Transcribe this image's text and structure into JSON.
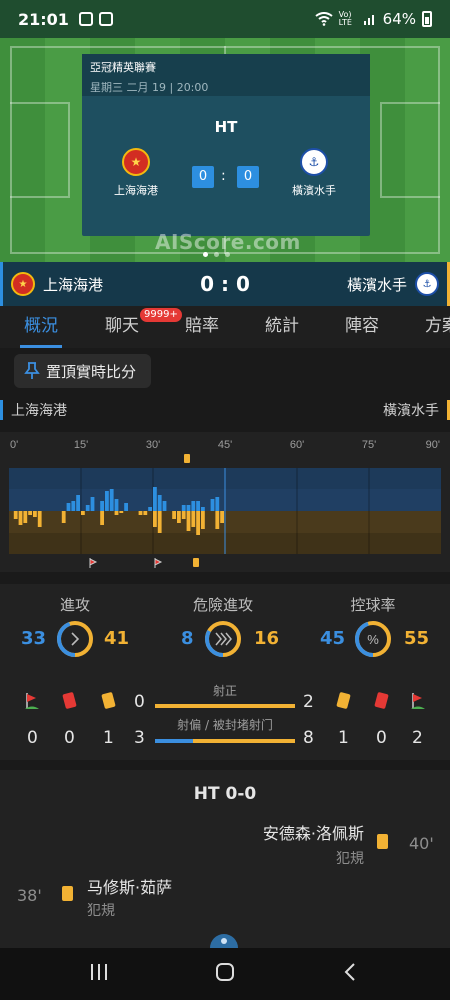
{
  "statusbar": {
    "time": "21:01",
    "battery": "64%",
    "network": "Vo) LTE"
  },
  "scorecard": {
    "competition": "亞冠精英聯賽",
    "date": "星期三 二月 19 | 20:00",
    "status": "HT",
    "home_name": "上海海港",
    "away_name": "橫濱水手",
    "home_score": "0",
    "away_score": "0",
    "separator": ":"
  },
  "watermark": "AIScore.com",
  "header": {
    "home": "上海海港",
    "away": "橫濱水手",
    "score": "0 : 0"
  },
  "tabs": [
    {
      "label": "概況",
      "active": true
    },
    {
      "label": "聊天",
      "badge": "9999+"
    },
    {
      "label": "賠率"
    },
    {
      "label": "統計"
    },
    {
      "label": "陣容"
    },
    {
      "label": "方案"
    }
  ],
  "pin_button": "置頂實時比分",
  "team_labels": {
    "home": "上海海港",
    "away": "橫濱水手"
  },
  "momentum": {
    "ticks": [
      "0'",
      "15'",
      "30'",
      "45'",
      "60'",
      "75'",
      "90'"
    ],
    "current_minute": 45,
    "home": [
      0,
      0,
      0,
      0,
      0,
      0,
      0,
      0,
      0,
      0,
      0,
      0,
      8,
      10,
      16,
      0,
      6,
      14,
      0,
      10,
      20,
      22,
      12,
      0,
      8,
      0,
      0,
      0,
      0,
      4,
      24,
      16,
      10,
      0,
      0,
      0,
      6,
      6,
      10,
      10,
      4,
      0,
      12,
      14,
      0
    ],
    "away": [
      0,
      8,
      14,
      12,
      4,
      6,
      16,
      0,
      0,
      0,
      0,
      12,
      0,
      0,
      0,
      4,
      0,
      0,
      0,
      14,
      0,
      0,
      4,
      2,
      0,
      0,
      0,
      4,
      4,
      0,
      16,
      22,
      0,
      0,
      8,
      12,
      8,
      20,
      16,
      24,
      18,
      0,
      0,
      18,
      12
    ]
  },
  "stats": {
    "attack": {
      "label": "進攻",
      "home": 33,
      "away": 41
    },
    "dangerous_attack": {
      "label": "危險進攻",
      "home": 8,
      "away": 16
    },
    "possession": {
      "label": "控球率",
      "home": 45,
      "away": 55
    },
    "shots_on_target": {
      "label": "射正",
      "home": 0,
      "away": 2
    },
    "shots_off": {
      "label": "射偏 / 被封堵射门",
      "home": 3,
      "away": 8
    },
    "home_corners": 0,
    "home_red": 0,
    "home_yellow": 1,
    "away_yellow": 1,
    "away_red": 0,
    "away_corners": 2
  },
  "events": {
    "half_time": "HT 0-0",
    "list": [
      {
        "side": "away",
        "player": "安德森·洛佩斯",
        "type": "犯規",
        "minute": "40'"
      },
      {
        "side": "home",
        "player": "马修斯·茹萨",
        "type": "犯規",
        "minute": "38'"
      }
    ]
  },
  "colors": {
    "home": "#3b8fe0",
    "away": "#f2b234",
    "accent": "#3b8fe0",
    "red_card": "#e53935"
  }
}
